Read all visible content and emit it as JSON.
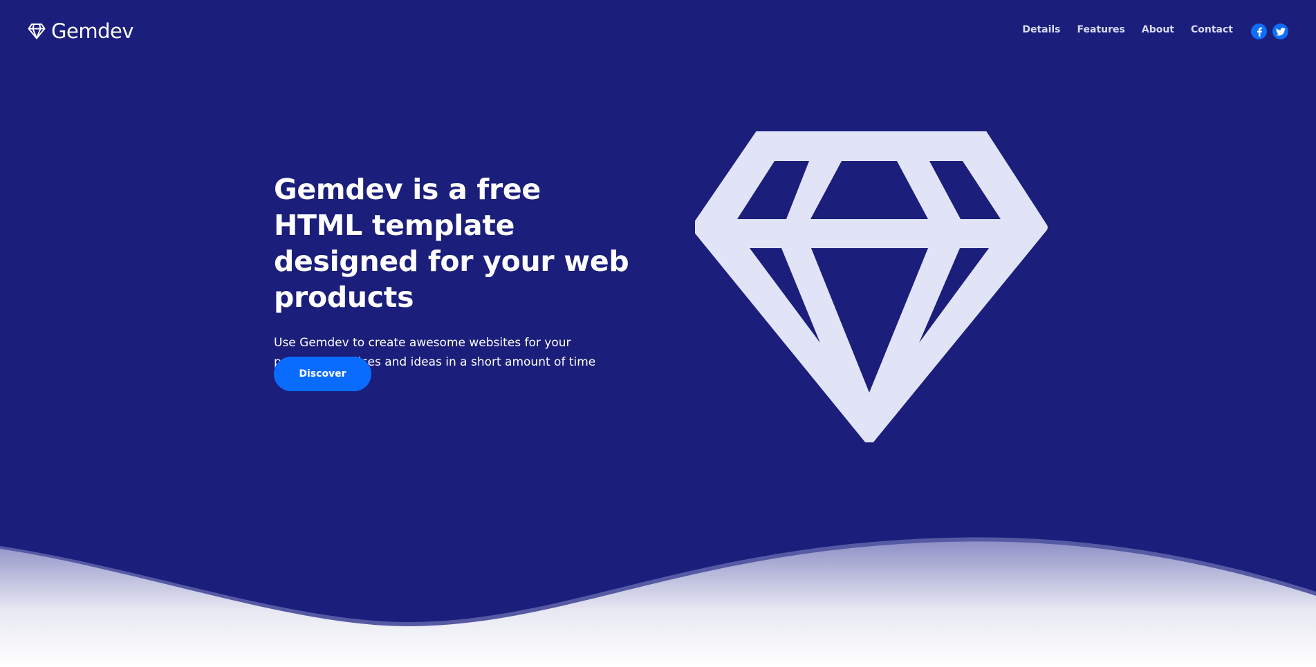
{
  "brand": {
    "name": "Gemdev",
    "icon": "diamond-icon"
  },
  "nav": {
    "links": [
      {
        "label": "Details"
      },
      {
        "label": "Features"
      },
      {
        "label": "About"
      },
      {
        "label": "Contact"
      }
    ],
    "socials": [
      {
        "icon": "facebook-icon"
      },
      {
        "icon": "twitter-icon"
      }
    ]
  },
  "hero": {
    "title": "Gemdev is a free HTML template designed for your web products",
    "subtitle": "Use Gemdev to create awesome websites for your products, services and ideas in a short amount of time",
    "button_label": "Discover",
    "illustration": "diamond-icon"
  },
  "colors": {
    "background": "#1b1e7a",
    "accent": "#0a6cff",
    "gem_fill": "#e1e4f7",
    "nav_text": "#d8dcf5"
  }
}
